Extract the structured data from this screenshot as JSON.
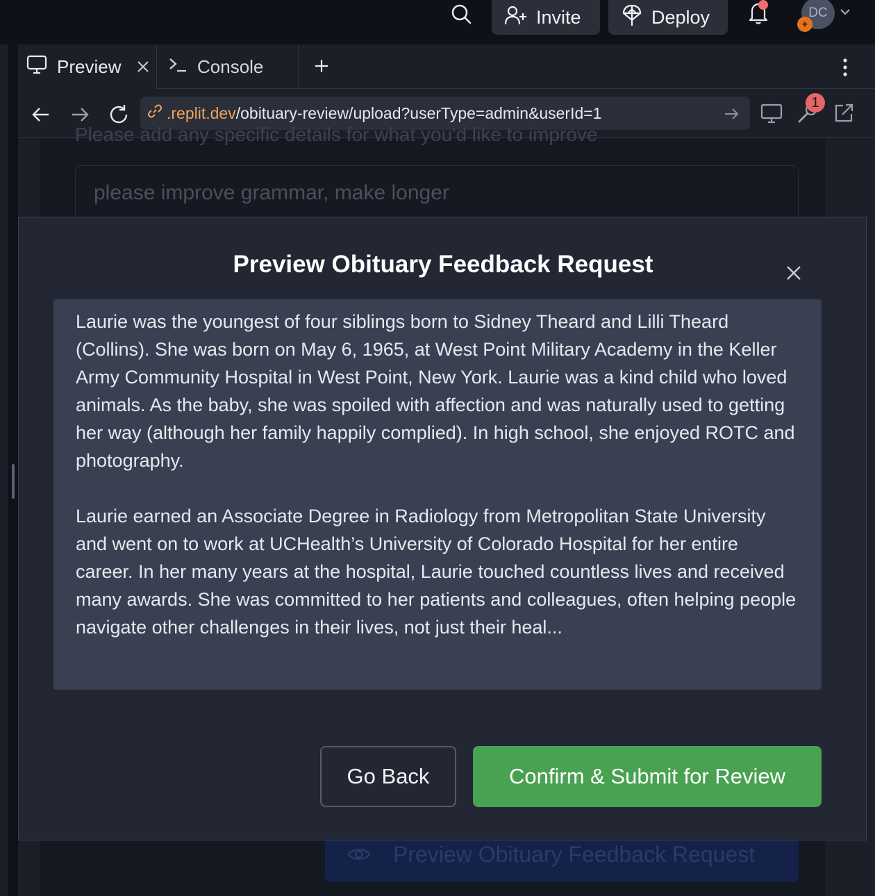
{
  "topbar": {
    "invite_label": "Invite",
    "deploy_label": "Deploy",
    "avatar_initials": "DC"
  },
  "tabs": [
    {
      "label": "Preview"
    },
    {
      "label": "Console"
    }
  ],
  "urlbar": {
    "host": ".replit.dev",
    "path": "/obituary-review/upload?userType=admin&userId=1",
    "notification_count": "1"
  },
  "background": {
    "label": "Please add any specific details for what you'd like to improve",
    "input_value": "please improve grammar, make longer",
    "button_label": "Preview Obituary Feedback Request"
  },
  "modal": {
    "title": "Preview Obituary Feedback Request",
    "paragraphs": [
      "Laurie was the youngest of four siblings born to Sidney Theard and Lilli Theard (Collins). She was born on May 6, 1965, at West Point Military Academy in the Keller Army Community Hospital in West Point, New York. Laurie was a kind child who loved animals. As the baby, she was spoiled with affection and was naturally used to getting her way (although her family happily complied). In high school, she enjoyed ROTC and photography.",
      "Laurie earned an Associate Degree in Radiology from Metropolitan State University and went on to work at UCHealth’s University of Colorado Hospital for her entire career. In her many years at the hospital, Laurie touched countless lives and received many awards. She was committed to her patients and colleagues, often helping people navigate other challenges in their lives, not just their heal..."
    ],
    "back_label": "Go Back",
    "submit_label": "Confirm & Submit for Review"
  },
  "colors": {
    "submit_green": "#49a251",
    "url_host": "#f0a35c",
    "notification_red": "#e46767"
  }
}
